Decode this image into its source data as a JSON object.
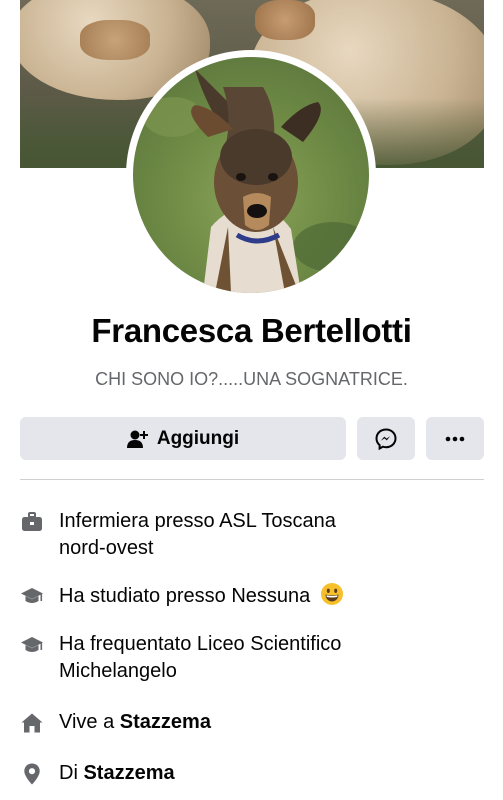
{
  "profile": {
    "name": "Francesca Bertellotti",
    "bio": "CHI SONO IO?.....UNA SOGNATRICE.",
    "cover_photo": "cover-photo-sheep",
    "profile_photo": "profile-photo-dog"
  },
  "actions": {
    "add_label": "Aggiungi",
    "add_icon": "add-friend-icon",
    "message_icon": "messenger-icon",
    "more_icon": "more-icon"
  },
  "intro": {
    "work": {
      "icon": "briefcase-icon",
      "text": "Infermiera presso ASL Toscana",
      "text_line2": "nord-ovest"
    },
    "studied": {
      "icon": "graduation-cap-icon",
      "text": "Ha studiato presso Nessuna",
      "emoji": "grinning-face-emoji"
    },
    "attended": {
      "icon": "graduation-cap-icon",
      "text": "Ha frequentato Liceo Scientifico",
      "text_line2": "Michelangelo"
    },
    "lives": {
      "icon": "home-icon",
      "prefix": "Vive a",
      "place": "Stazzema"
    },
    "from": {
      "icon": "location-pin-icon",
      "prefix": "Di",
      "place": "Stazzema"
    }
  },
  "colors": {
    "button_bg": "#e4e6eb",
    "secondary_text": "#65676b",
    "icon": "#65676b",
    "divider": "#ced0d4"
  }
}
